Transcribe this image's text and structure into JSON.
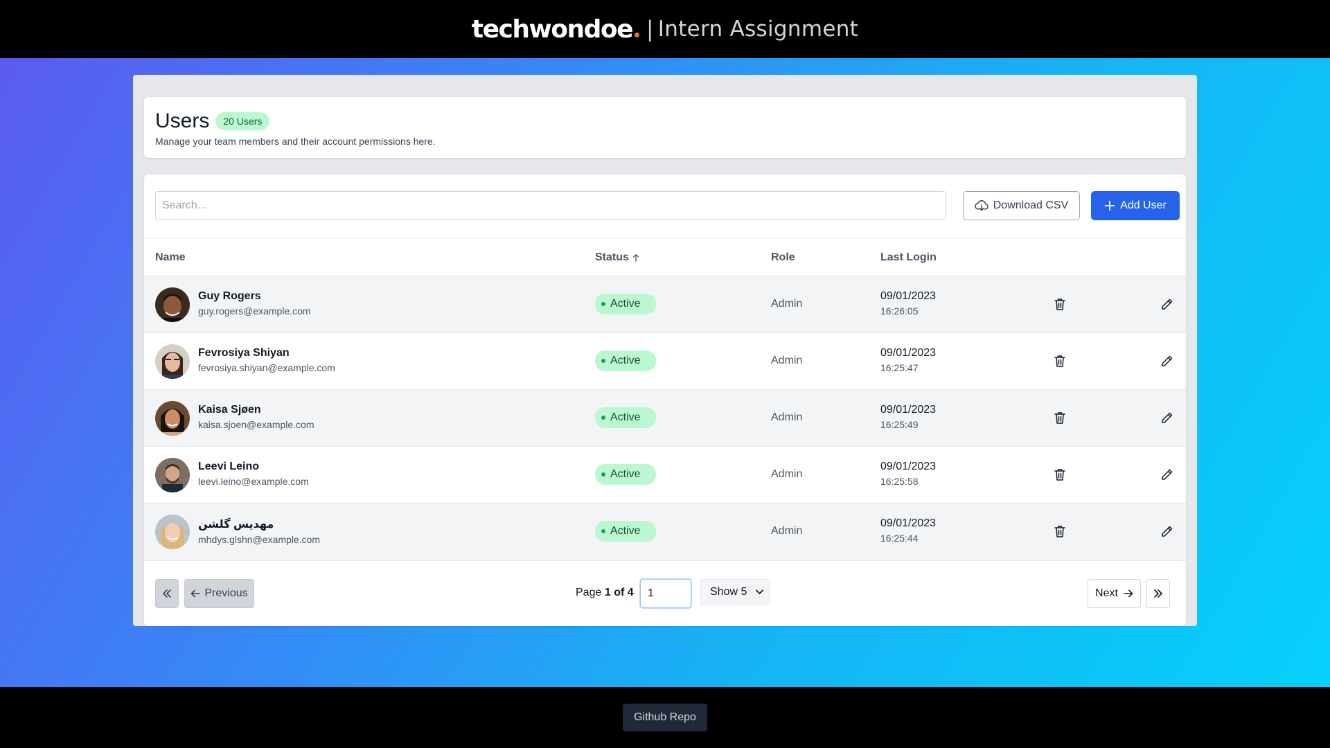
{
  "header": {
    "logo": "techwondoe",
    "separator": "|",
    "subtitle": "Intern Assignment"
  },
  "users_card": {
    "title": "Users",
    "count_badge": "20 Users",
    "description": "Manage your team members and their account permissions here."
  },
  "toolbar": {
    "search_placeholder": "Search...",
    "search_value": "",
    "download_label": "Download CSV",
    "add_label": "Add User"
  },
  "columns": {
    "name": "Name",
    "status": "Status",
    "role": "Role",
    "last_login": "Last Login"
  },
  "rows": [
    {
      "name": "Guy Rogers",
      "email": "guy.rogers@example.com",
      "status": "Active",
      "role": "Admin",
      "date": "09/01/2023",
      "time": "16:26:05"
    },
    {
      "name": "Fevrosiya Shiyan",
      "email": "fevrosiya.shiyan@example.com",
      "status": "Active",
      "role": "Admin",
      "date": "09/01/2023",
      "time": "16:25:47"
    },
    {
      "name": "Kaisa Sjøen",
      "email": "kaisa.sjoen@example.com",
      "status": "Active",
      "role": "Admin",
      "date": "09/01/2023",
      "time": "16:25:49"
    },
    {
      "name": "Leevi Leino",
      "email": "leevi.leino@example.com",
      "status": "Active",
      "role": "Admin",
      "date": "09/01/2023",
      "time": "16:25:58"
    },
    {
      "name": "مهدیس گلشن",
      "email": "mhdys.glshn@example.com",
      "status": "Active",
      "role": "Admin",
      "date": "09/01/2023",
      "time": "16:25:44"
    }
  ],
  "pagination": {
    "previous_label": "Previous",
    "next_label": "Next",
    "page_label": "Page",
    "current_page": "1",
    "of_label": "of",
    "total_pages": "4",
    "page_input_value": "1",
    "show_label": "Show 5"
  },
  "footer": {
    "github_label": "Github Repo"
  },
  "colors": {
    "primary": "#2563eb",
    "active_badge_bg": "#bbf7d0",
    "active_dot": "#16a34a",
    "logo_dot": "#f97316"
  },
  "icons": {
    "download": "cloud-download-icon",
    "add": "plus-icon",
    "sort": "arrow-up-icon",
    "delete": "trash-icon",
    "edit": "pencil-icon",
    "first": "double-chevron-left-icon",
    "previous": "arrow-left-icon",
    "next": "arrow-right-icon",
    "last": "double-chevron-right-icon"
  }
}
